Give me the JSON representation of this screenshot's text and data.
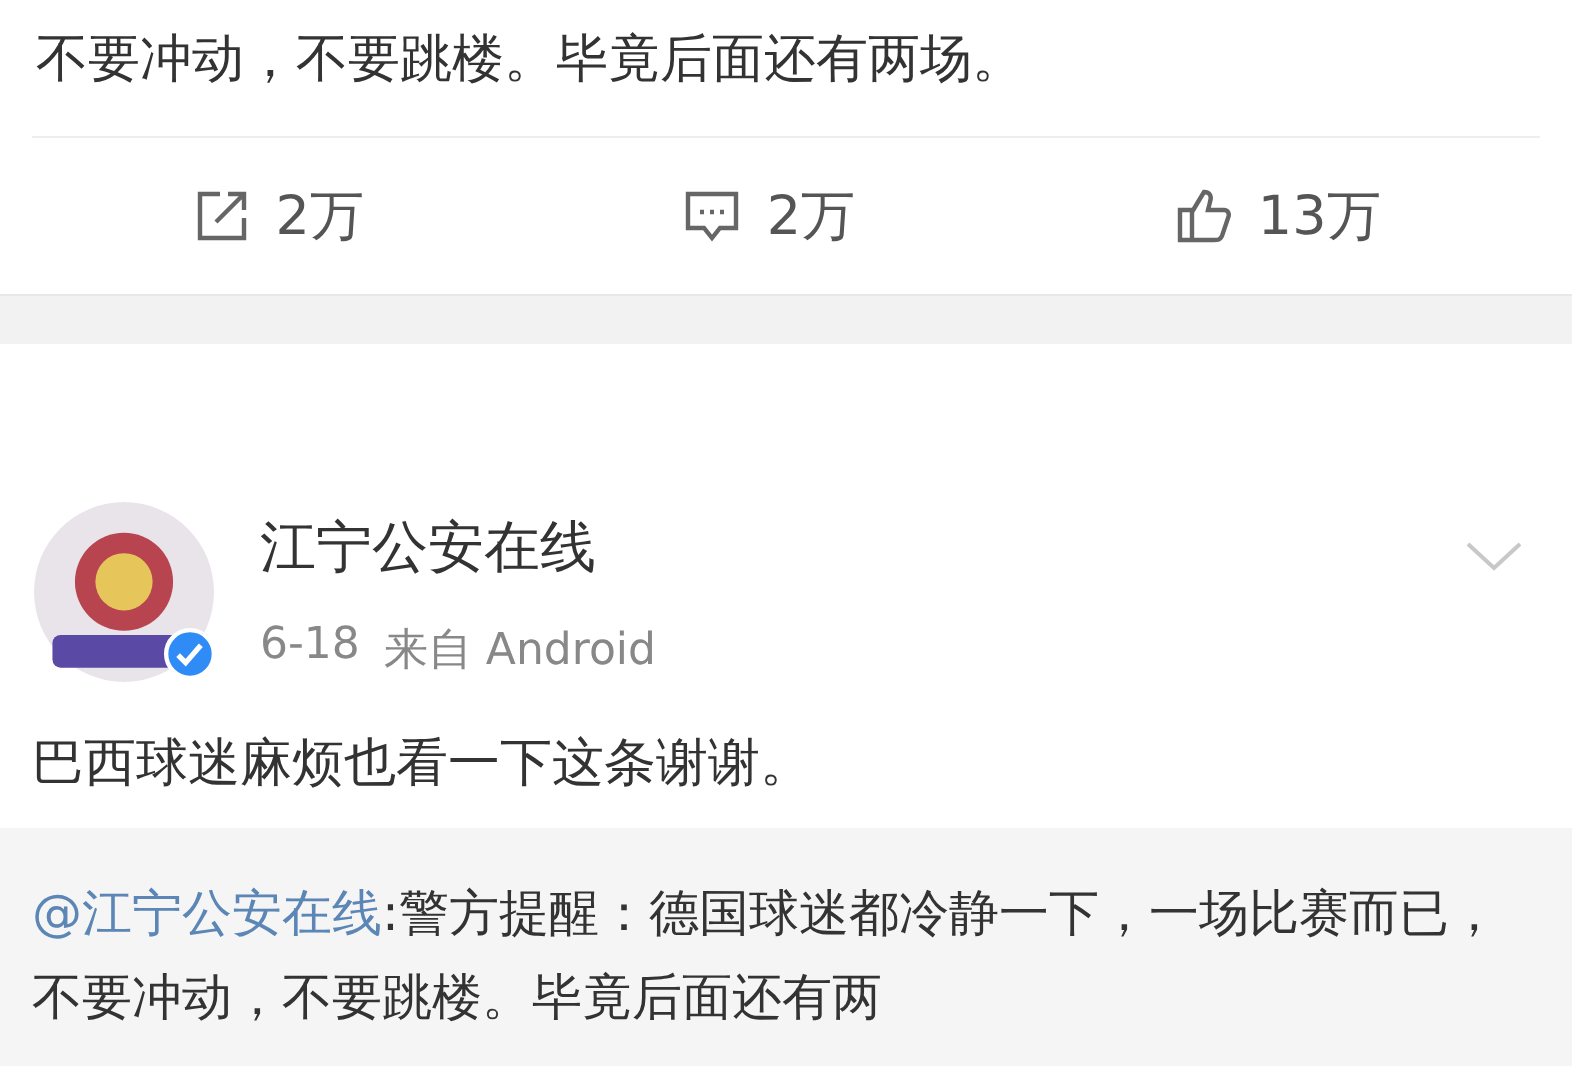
{
  "previous_post": {
    "text_tail": "不要冲动，不要跳楼。毕竟后面还有两场。",
    "actions": [
      {
        "kind": "repost",
        "count": "2万"
      },
      {
        "kind": "comment",
        "count": "2万"
      },
      {
        "kind": "like",
        "count": "13万"
      }
    ]
  },
  "post": {
    "author": "江宁公安在线",
    "verified": true,
    "date": "6-18",
    "source": "来自 Android",
    "text": "巴西球迷麻烦也看一下这条谢谢。",
    "repost": {
      "mention": "@江宁公安在线",
      "text": ":警方提醒：德国球迷都冷静一下，一场比赛而已，不要冲动，不要跳楼。毕竟后面还有两"
    }
  }
}
